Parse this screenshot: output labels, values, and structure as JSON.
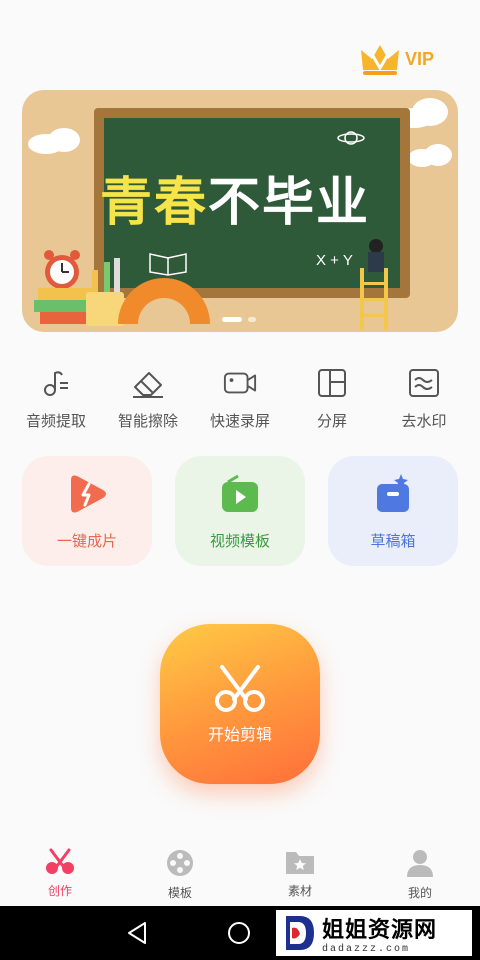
{
  "vip": {
    "label": "VIP"
  },
  "banner": {
    "title_part1": "青春",
    "title_part2": "不毕业",
    "formula": "X + Y"
  },
  "tools": [
    {
      "label": "音频提取",
      "icon": "audio-extract-icon"
    },
    {
      "label": "智能擦除",
      "icon": "eraser-icon"
    },
    {
      "label": "快速录屏",
      "icon": "video-camera-icon"
    },
    {
      "label": "分屏",
      "icon": "split-screen-icon"
    },
    {
      "label": "去水印",
      "icon": "remove-watermark-icon"
    }
  ],
  "cards": [
    {
      "label": "一键成片",
      "icon": "one-click-video-icon"
    },
    {
      "label": "视频模板",
      "icon": "video-template-icon"
    },
    {
      "label": "草稿箱",
      "icon": "drafts-icon"
    }
  ],
  "start": {
    "label": "开始剪辑"
  },
  "nav": [
    {
      "label": "创作",
      "icon": "scissors-icon"
    },
    {
      "label": "模板",
      "icon": "film-reel-icon"
    },
    {
      "label": "素材",
      "icon": "star-folder-icon"
    },
    {
      "label": "我的",
      "icon": "person-icon"
    }
  ],
  "watermark": {
    "title": "姐姐资源网",
    "url": "dadazzz.com"
  },
  "colors": {
    "accent": "#f23f64",
    "start_gradient": [
      "#ffcb45",
      "#ff6f3a"
    ]
  }
}
